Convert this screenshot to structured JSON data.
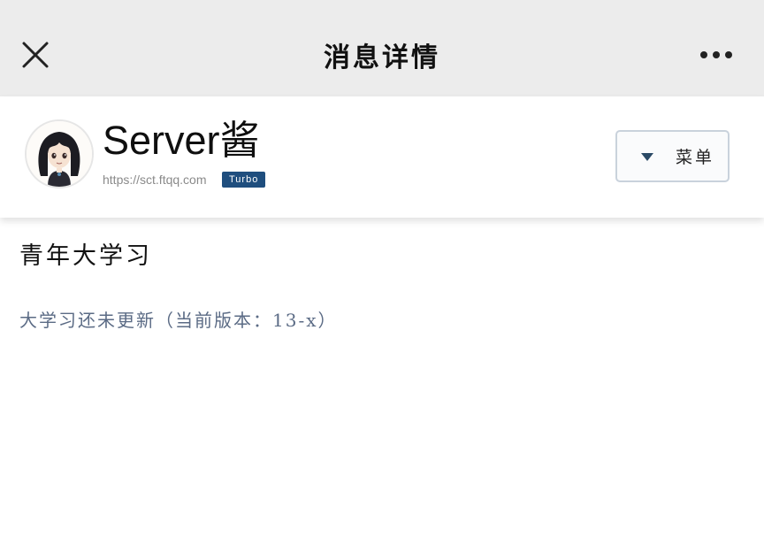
{
  "nav": {
    "title": "消息详情",
    "close_icon": "close-icon",
    "more_icon": "more-dots-icon"
  },
  "header": {
    "avatar_icon": "anime-girl-avatar",
    "name": "Server酱",
    "url": "https://sct.ftqq.com",
    "badge": "Turbo",
    "badge_color": "#1f4e7e",
    "menu_label": "菜单",
    "menu_icon": "caret-down-icon"
  },
  "message": {
    "title": "青年大学习",
    "body": "大学习还未更新（当前版本：13-x）",
    "body_color": "#5b6b85"
  }
}
